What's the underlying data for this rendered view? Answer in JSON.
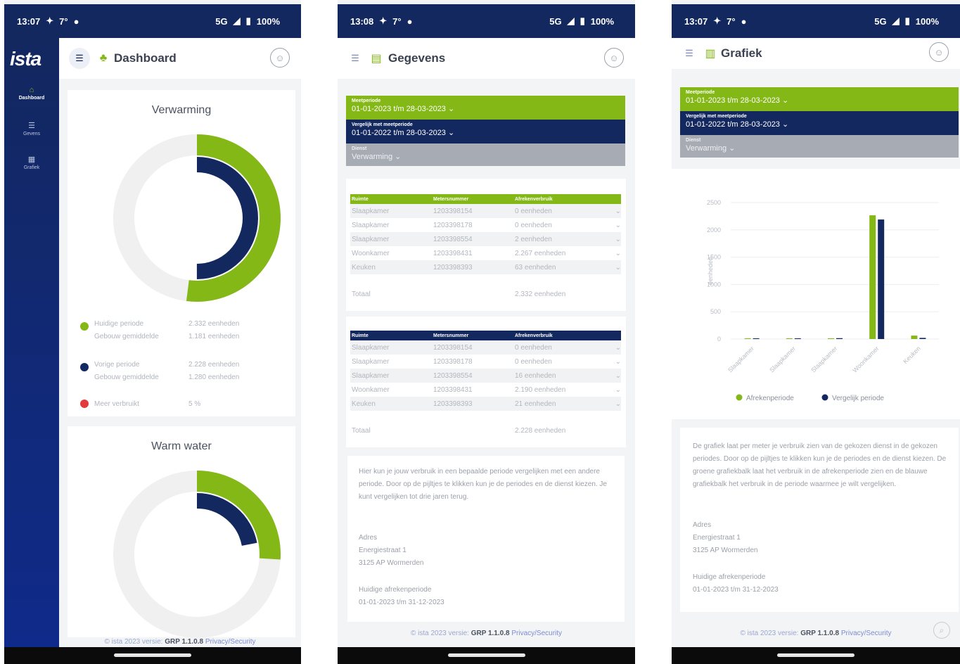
{
  "colors": {
    "navy": "#13285f",
    "green": "#84b817",
    "grey_track": "#f0f0f0",
    "red": "#e23b3b"
  },
  "footer": {
    "prefix": "© ista 2023 versie:",
    "version": "GRP 1.1.0.8",
    "link": "Privacy/Security"
  },
  "screens": [
    {
      "status": {
        "time": "13:07",
        "temp": "7°",
        "network": "5G",
        "battery": "100%"
      },
      "sidebar": {
        "logo": "ista",
        "items": [
          {
            "label": "Dashboard",
            "icon": "home-icon"
          },
          {
            "label": "Gevens",
            "icon": "list-icon"
          },
          {
            "label": "Grafiek",
            "icon": "chart-icon"
          }
        ]
      },
      "header": {
        "title": "Dashboard",
        "icon": "dashboard-icon"
      },
      "heating": {
        "title": "Verwarming",
        "current_fraction": 0.52,
        "previous_fraction": 0.5,
        "legend": [
          {
            "label1": "Huidige periode",
            "value1": "2.332 eenheden",
            "label2": "Gebouw gemiddelde",
            "value2": "1.181 eenheden",
            "color": "#84b817"
          },
          {
            "label1": "Vorige periode",
            "value1": "2.228 eenheden",
            "label2": "Gebouw gemiddelde",
            "value2": "1.280 eenheden",
            "color": "#13285f"
          }
        ],
        "extra": {
          "label": "Meer verbruikt",
          "value": "5 %",
          "color": "#e23b3b"
        }
      },
      "water": {
        "title": "Warm water",
        "current_fraction": 0.26,
        "previous_fraction": 0.22
      }
    },
    {
      "status": {
        "time": "13:08",
        "temp": "7°",
        "network": "5G",
        "battery": "100%"
      },
      "header": {
        "title": "Gegevens",
        "icon": "database-icon"
      },
      "filters": [
        {
          "label": "Meetperiode",
          "value": "01-01-2023 t/m 28-03-2023 ⌄",
          "style": "green"
        },
        {
          "label": "Vergelijk met meetperiode",
          "value": "01-01-2022 t/m 28-03-2023 ⌄",
          "style": "navy"
        },
        {
          "label": "Dienst",
          "value": "Verwarming ⌄",
          "style": "grey"
        }
      ],
      "tables": [
        {
          "headers": [
            "Ruimte",
            "Metersnummer",
            "Afrekenverbruik"
          ],
          "rows": [
            [
              "Slaapkamer",
              "1203398154",
              "0 eenheden"
            ],
            [
              "Slaapkamer",
              "1203398178",
              "0 eenheden"
            ],
            [
              "Slaapkamer",
              "1203398554",
              "2 eenheden"
            ],
            [
              "Woonkamer",
              "1203398431",
              "2.267 eenheden"
            ],
            [
              "Keuken",
              "1203398393",
              "63 eenheden"
            ]
          ],
          "total_label": "Totaal",
          "total_value": "2.332 eenheden",
          "color": "#84b817"
        },
        {
          "headers": [
            "Ruimte",
            "Metersnummer",
            "Afrekenverbruik"
          ],
          "rows": [
            [
              "Slaapkamer",
              "1203398154",
              "0 eenheden"
            ],
            [
              "Slaapkamer",
              "1203398178",
              "0 eenheden"
            ],
            [
              "Slaapkamer",
              "1203398554",
              "16 eenheden"
            ],
            [
              "Woonkamer",
              "1203398431",
              "2.190 eenheden"
            ],
            [
              "Keuken",
              "1203398393",
              "21 eenheden"
            ]
          ],
          "total_label": "Totaal",
          "total_value": "2.228 eenheden",
          "color": "#13285f"
        }
      ],
      "info": {
        "text": "Hier kun je jouw verbruik in een bepaalde periode vergelijken met een andere periode. Door op de pijltjes te klikken kun je de periodes en de dienst kiezen. Je kunt vergelijken tot drie jaren terug.",
        "address_label": "Adres",
        "address_line1": "Energiestraat 1",
        "address_line2": "3125 AP Wormerden",
        "period_label": "Huidige afrekenperiode",
        "period_value": "01-01-2023 t/m 31-12-2023"
      }
    },
    {
      "status": {
        "time": "13:07",
        "temp": "7°",
        "network": "5G",
        "battery": "100%"
      },
      "header": {
        "title": "Grafiek",
        "icon": "chart-icon"
      },
      "filters": [
        {
          "label": "Meetperiode",
          "value": "01-01-2023 t/m 28-03-2023 ⌄",
          "style": "green"
        },
        {
          "label": "Vergelijk met meetperiode",
          "value": "01-01-2022 t/m 28-03-2023 ⌄",
          "style": "navy"
        },
        {
          "label": "Dienst",
          "value": "Verwarming ⌄",
          "style": "grey"
        }
      ],
      "chart_data": {
        "type": "bar",
        "categories": [
          "Slaapkamer",
          "Slaapkamer",
          "Slaapkamer",
          "Woonkamer",
          "Keuken"
        ],
        "series": [
          {
            "name": "Afrekenperiode",
            "values": [
              0,
              0,
              2,
              2267,
              63
            ],
            "color": "#84b817"
          },
          {
            "name": "Vergelijk periode",
            "values": [
              0,
              0,
              16,
              2190,
              21
            ],
            "color": "#13285f"
          }
        ],
        "ylabel": "eenheden",
        "ylim": [
          0,
          2500
        ],
        "yticks": [
          0,
          500,
          1000,
          1500,
          2000,
          2500
        ],
        "grid": true,
        "legend": "bottom"
      },
      "info": {
        "text": "De grafiek laat per meter je verbruik zien van de gekozen dienst in de gekozen periodes. Door op de pijltjes te klikken kun je de periodes en de dienst kiezen. De groene grafiekbalk laat het verbruik in de afrekenperiode zien en de blauwe grafiekbalk het verbruik in de periode waarmee je wilt vergelijken.",
        "address_label": "Adres",
        "address_line1": "Energiestraat 1",
        "address_line2": "3125 AP Wormerden",
        "period_label": "Huidige afrekenperiode",
        "period_value": "01-01-2023 t/m 31-12-2023"
      }
    }
  ]
}
